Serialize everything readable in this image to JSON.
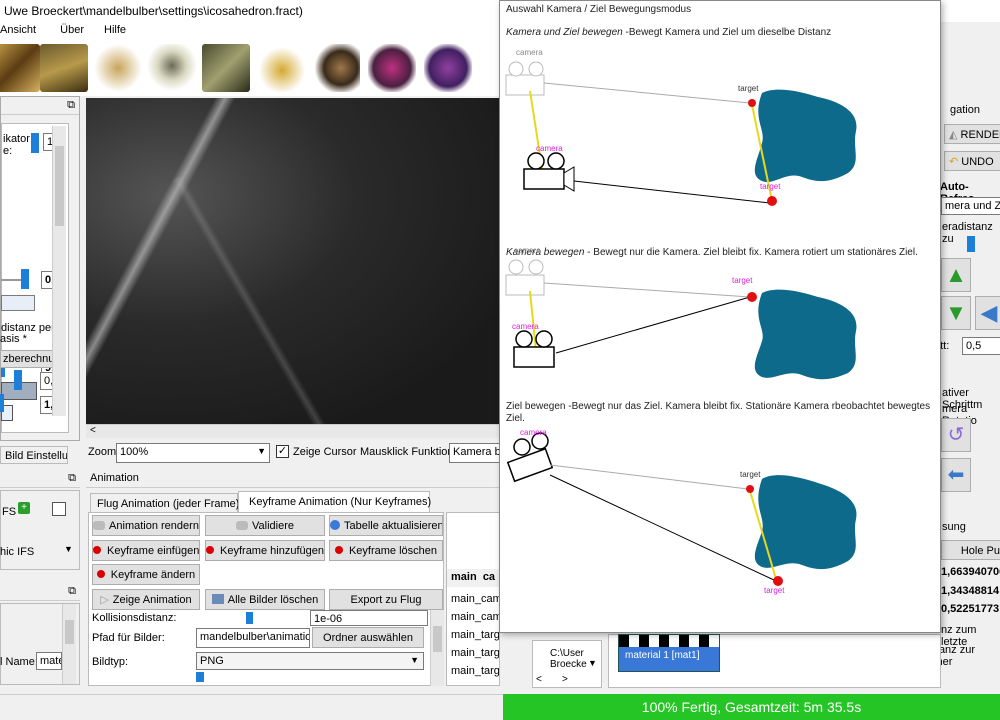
{
  "window": {
    "title": "Uwe Broeckert\\mandelbulber\\settings\\icosahedron.fract)"
  },
  "menu": {
    "items": [
      "Ansicht",
      "Über",
      "Hilfe"
    ]
  },
  "toolbar": {
    "presets": [
      "preset-1",
      "preset-2",
      "preset-3",
      "preset-4",
      "preset-5",
      "preset-6",
      "preset-7",
      "preset-8",
      "preset-9"
    ]
  },
  "left_panel": {
    "multiplier_label": "ikator",
    "scale_label": "e:",
    "spin1_value": "1",
    "value_0": "0,",
    "distance_label": "distanz per",
    "value_9": "9,",
    "basis_label": "asis *",
    "berechnung_label": "zberechnun",
    "value_0b": "0,",
    "value_1": "1,",
    "bild_einst": "Bild Einstellu..."
  },
  "render_view": {
    "zoom_label": "Zoom:",
    "zoom_value": "100%",
    "show_cursor_label": "Zeige Cursor",
    "mouse_func_label": "Mausklick Funktion:",
    "mouse_func_value": "Kamera be"
  },
  "ifs_panel": {
    "ifs_label": "FS",
    "ifs_label2": "hic IFS"
  },
  "material_panel": {
    "name_label": "l Name:",
    "name_value": "mate"
  },
  "animation": {
    "header": "Animation",
    "tab_flight": "Flug Animation (jeder Frame)",
    "tab_keyframe": "Keyframe Animation (Nur Keyframes)",
    "btn_render": "Animation rendern",
    "btn_validate": "Validiere",
    "btn_refresh_table": "Tabelle aktualisieren",
    "btn_insert_kf": "Keyframe einfügen",
    "btn_add_kf": "Keyframe hinzufügen",
    "btn_delete_kf": "Keyframe löschen",
    "btn_change_kf": "Keyframe ändern",
    "btn_show_anim": "Zeige Animation",
    "btn_delete_all": "Alle Bilder löschen",
    "btn_export": "Export zu Flug",
    "collision_label": "Kollisionsdistanz:",
    "collision_value": "1e-06",
    "path_label": "Pfad für Bilder:",
    "path_value": "mandelbulber\\animation\\",
    "btn_select_folder": "Ordner auswählen",
    "type_label": "Bildtyp:",
    "type_value": "PNG"
  },
  "kf_table": {
    "headers": [
      "main",
      "ca"
    ],
    "rows": [
      "main_came",
      "main_came",
      "main_targ",
      "main_targ",
      "main_targ"
    ]
  },
  "file_panel": {
    "path": "C:\\User Broecke"
  },
  "material_item": {
    "label": "material 1 [mat1]"
  },
  "right_panel": {
    "nav_header": "gation",
    "btn_render": "RENDER",
    "btn_undo": "UNDO",
    "auto_refresh": "Auto-Refres",
    "mode_select": "mera und Ziel",
    "distance_label": "eradistanz zu",
    "step_label": "ritt:",
    "step_value": "0,5",
    "relative_step": "ativer Schrittm",
    "rotation_label": "mera Rotatio",
    "section_label": "sung",
    "hole_label": "Hole Pu",
    "coord1": "1,663940706",
    "coord2": "1,34348814",
    "coord3": "0,52251773",
    "dist_last": "nz zum letzte",
    "dist_camera": "Distanz zur Kamer"
  },
  "popup": {
    "title": "Auswahl Kamera / Ziel Bewegungsmodus",
    "mode1_name": "Kamera und Ziel bewegen",
    "mode1_desc": " -Bewegt Kamera und Ziel um dieselbe Distanz",
    "mode2_name": "Kamera bewegen",
    "mode2_desc": " - Bewegt nur die Kamera. Ziel bleibt fix. Kamera rotiert um stationäres Ziel.",
    "mode3_line1": "Ziel bewegen -Bewegt nur das Ziel. Kamera bleibt fix. Stationäre Kamera rbeobachtet bewegtes",
    "mode3_line2": "Ziel.",
    "label_camera": "camera",
    "label_target": "target"
  },
  "status": {
    "text": "100% Fertig, Gesamtzeit: 5m 35.5s"
  },
  "colors": {
    "status_green": "#26c526",
    "fractal_blue": "#0e6a8a",
    "target_red": "#e01010",
    "label_magenta": "#e020e0",
    "arrow_yellow": "#e8d81c"
  }
}
